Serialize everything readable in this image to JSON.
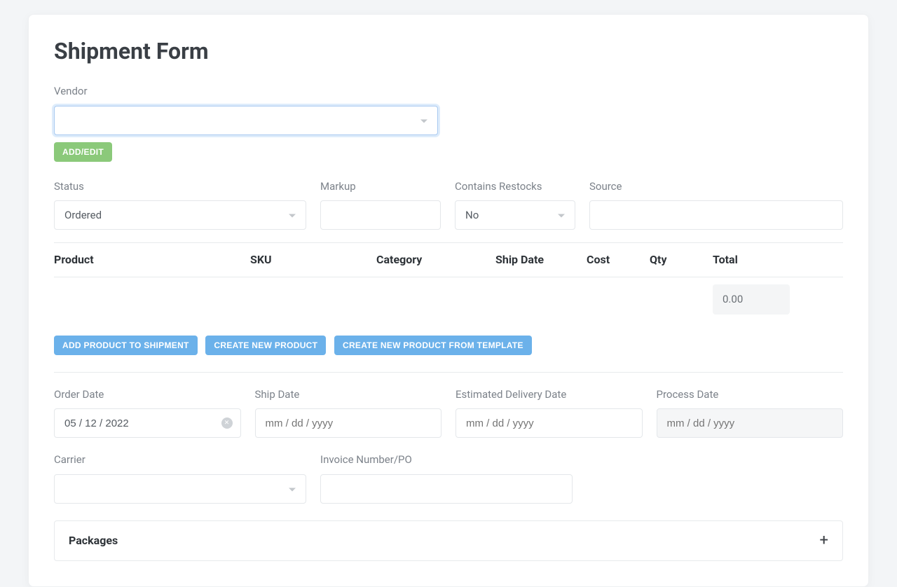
{
  "page_title": "Shipment Form",
  "vendor": {
    "label": "Vendor",
    "value": "",
    "add_edit_label": "ADD/EDIT"
  },
  "status": {
    "label": "Status",
    "value": "Ordered"
  },
  "markup": {
    "label": "Markup",
    "value": "",
    "suffix": "%"
  },
  "restocks": {
    "label": "Contains Restocks",
    "value": "No"
  },
  "source": {
    "label": "Source",
    "value": ""
  },
  "table": {
    "headers": {
      "product": "Product",
      "sku": "SKU",
      "category": "Category",
      "ship_date": "Ship Date",
      "cost": "Cost",
      "qty": "Qty",
      "total": "Total"
    },
    "total_value": "0.00"
  },
  "buttons": {
    "add_product": "ADD PRODUCT TO SHIPMENT",
    "create_product": "CREATE NEW PRODUCT",
    "create_from_template": "CREATE NEW PRODUCT FROM TEMPLATE"
  },
  "dates": {
    "order": {
      "label": "Order Date",
      "value": "05 / 12 / 2022"
    },
    "ship": {
      "label": "Ship Date",
      "placeholder": "mm / dd / yyyy"
    },
    "edd": {
      "label": "Estimated Delivery Date",
      "placeholder": "mm / dd / yyyy"
    },
    "process": {
      "label": "Process Date",
      "placeholder": "mm / dd / yyyy"
    }
  },
  "carrier": {
    "label": "Carrier",
    "value": ""
  },
  "invoice": {
    "label": "Invoice Number/PO",
    "value": ""
  },
  "packages": {
    "title": "Packages"
  }
}
